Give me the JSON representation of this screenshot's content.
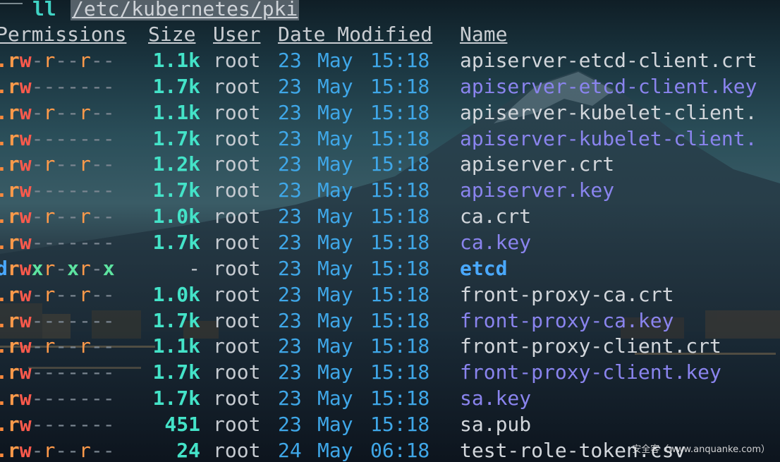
{
  "prompt": {
    "command": "ll",
    "path": "/etc/kubernetes/pki"
  },
  "headers": {
    "permissions": "Permissions",
    "size": "Size",
    "user": "User",
    "date_modified": "Date Modified",
    "name": "Name"
  },
  "rows": [
    {
      "perm": ".rw-r--r--",
      "size": "1.1k",
      "user": "root",
      "day": "23",
      "month": "May",
      "time": "15:18",
      "name": "apiserver-etcd-client.crt",
      "kind": "file"
    },
    {
      "perm": ".rw-------",
      "size": "1.7k",
      "user": "root",
      "day": "23",
      "month": "May",
      "time": "15:18",
      "name": "apiserver-etcd-client.key",
      "kind": "key"
    },
    {
      "perm": ".rw-r--r--",
      "size": "1.1k",
      "user": "root",
      "day": "23",
      "month": "May",
      "time": "15:18",
      "name": "apiserver-kubelet-client.",
      "kind": "file"
    },
    {
      "perm": ".rw-------",
      "size": "1.7k",
      "user": "root",
      "day": "23",
      "month": "May",
      "time": "15:18",
      "name": "apiserver-kubelet-client.",
      "kind": "key"
    },
    {
      "perm": ".rw-r--r--",
      "size": "1.2k",
      "user": "root",
      "day": "23",
      "month": "May",
      "time": "15:18",
      "name": "apiserver.crt",
      "kind": "file"
    },
    {
      "perm": ".rw-------",
      "size": "1.7k",
      "user": "root",
      "day": "23",
      "month": "May",
      "time": "15:18",
      "name": "apiserver.key",
      "kind": "key"
    },
    {
      "perm": ".rw-r--r--",
      "size": "1.0k",
      "user": "root",
      "day": "23",
      "month": "May",
      "time": "15:18",
      "name": "ca.crt",
      "kind": "file"
    },
    {
      "perm": ".rw-------",
      "size": "1.7k",
      "user": "root",
      "day": "23",
      "month": "May",
      "time": "15:18",
      "name": "ca.key",
      "kind": "key"
    },
    {
      "perm": "drwxr-xr-x",
      "size": "-",
      "user": "root",
      "day": "23",
      "month": "May",
      "time": "15:18",
      "name": "etcd",
      "kind": "dir"
    },
    {
      "perm": ".rw-r--r--",
      "size": "1.0k",
      "user": "root",
      "day": "23",
      "month": "May",
      "time": "15:18",
      "name": "front-proxy-ca.crt",
      "kind": "file"
    },
    {
      "perm": ".rw-------",
      "size": "1.7k",
      "user": "root",
      "day": "23",
      "month": "May",
      "time": "15:18",
      "name": "front-proxy-ca.key",
      "kind": "key"
    },
    {
      "perm": ".rw-r--r--",
      "size": "1.1k",
      "user": "root",
      "day": "23",
      "month": "May",
      "time": "15:18",
      "name": "front-proxy-client.crt",
      "kind": "file"
    },
    {
      "perm": ".rw-------",
      "size": "1.7k",
      "user": "root",
      "day": "23",
      "month": "May",
      "time": "15:18",
      "name": "front-proxy-client.key",
      "kind": "key"
    },
    {
      "perm": ".rw-------",
      "size": "1.7k",
      "user": "root",
      "day": "23",
      "month": "May",
      "time": "15:18",
      "name": "sa.key",
      "kind": "key"
    },
    {
      "perm": ".rw-------",
      "size": "451",
      "user": "root",
      "day": "23",
      "month": "May",
      "time": "15:18",
      "name": "sa.pub",
      "kind": "file"
    },
    {
      "perm": ".rw-r--r--",
      "size": "24",
      "user": "root",
      "day": "24",
      "month": "May",
      "time": "06:18",
      "name": "test-role-token.csv",
      "kind": "file"
    }
  ],
  "watermark": "安全客（www.anquanke.com）",
  "colors": {
    "size": "#44e3c8",
    "date": "#3fa7e8",
    "key_name": "#8a84ee",
    "dir_name": "#4aa9ff",
    "perm_write": "#ff5a4c",
    "perm_read": "#ff9a4a",
    "perm_exec": "#5de3a0"
  }
}
